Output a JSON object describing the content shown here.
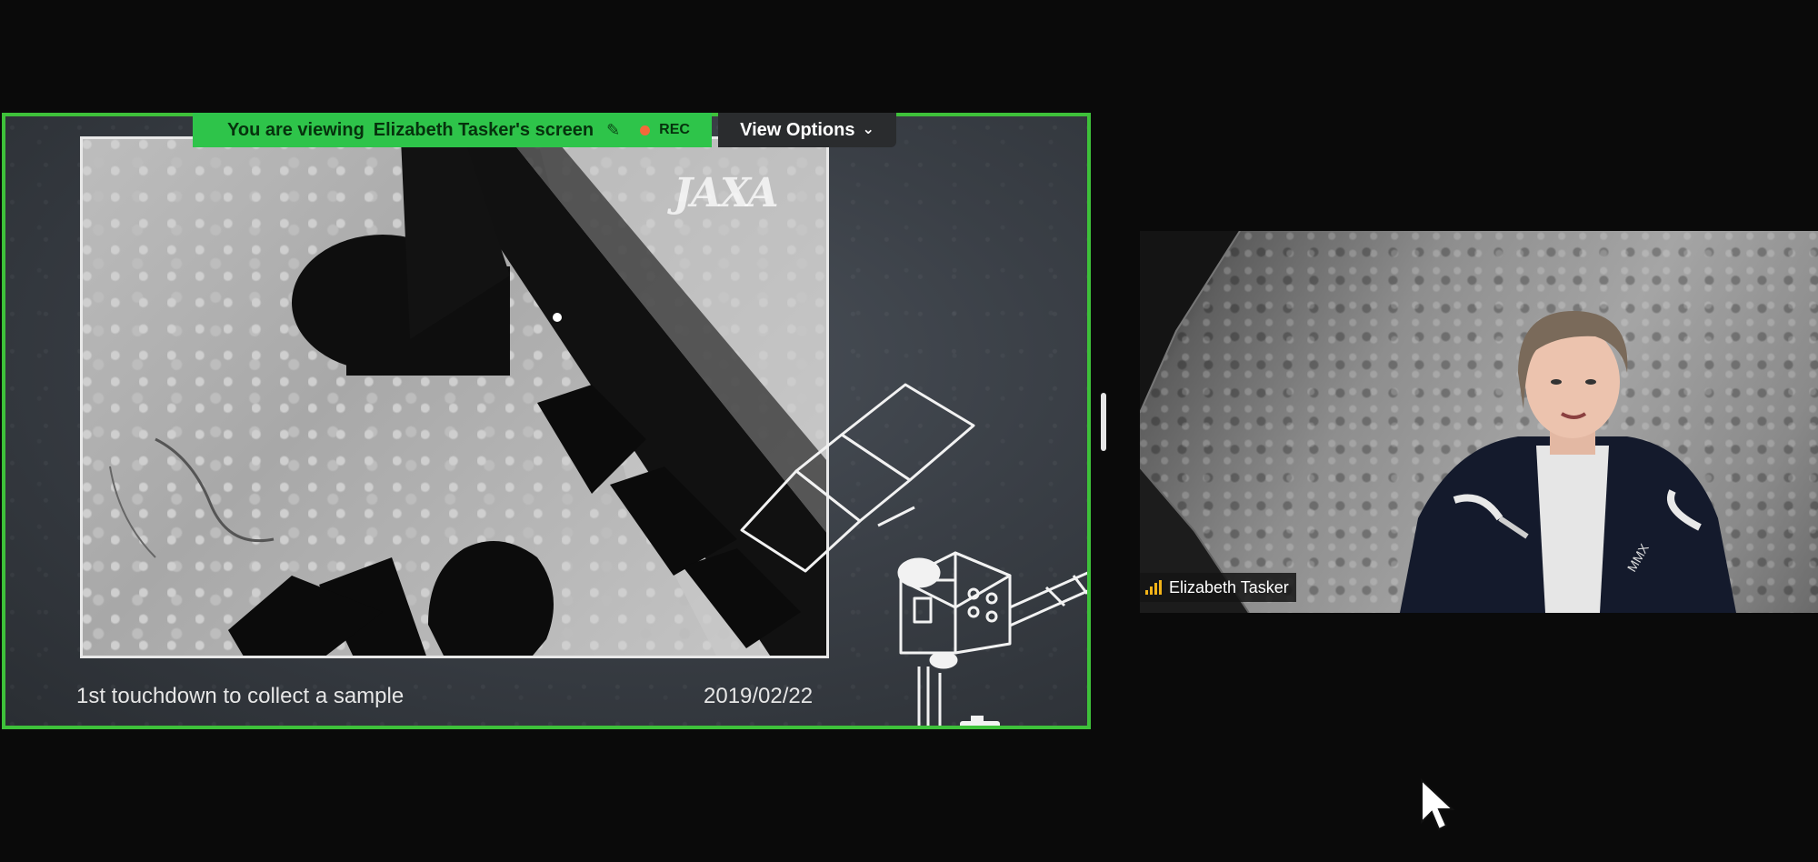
{
  "banner": {
    "viewing_label": "You are viewing",
    "presenter_screen": "Elizabeth Tasker's screen",
    "annotate_icon": "pen-slash-icon",
    "rec_label": "REC",
    "rec_color": "#f36a3a",
    "background_color": "#2ec44a"
  },
  "view_options": {
    "label": "View Options",
    "icon": "chevron-down-icon"
  },
  "shared_screen": {
    "border_color": "#3ec13a",
    "logo_text": "JAXA",
    "caption_left": "1st touchdown to collect a sample",
    "caption_right": "2019/02/22"
  },
  "video_tile": {
    "participant_name": "Elizabeth Tasker",
    "signal_icon": "signal-bars-icon",
    "signal_color": "#f2b318"
  },
  "cursor": {
    "icon": "mouse-pointer-icon"
  }
}
